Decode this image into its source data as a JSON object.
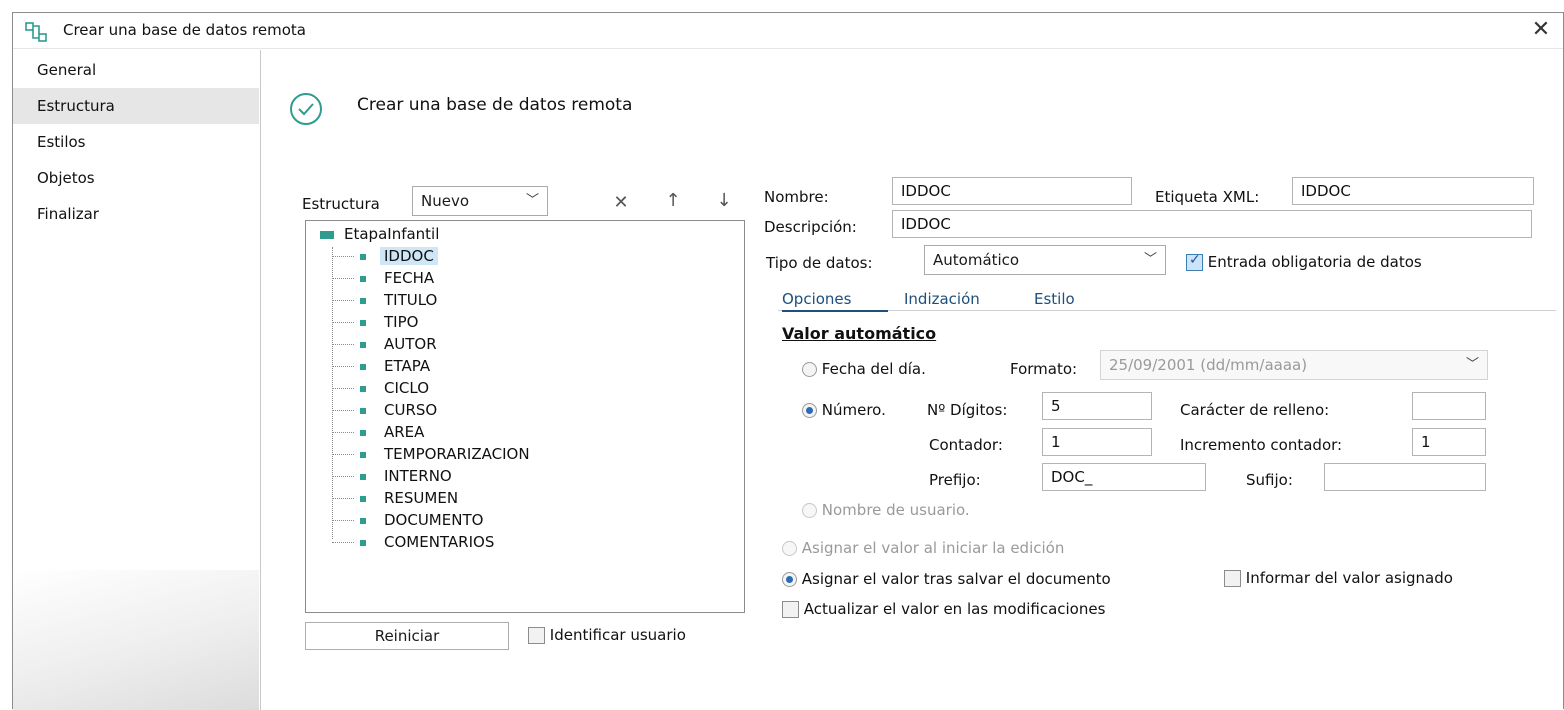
{
  "window": {
    "title": "Crear una base de datos remota"
  },
  "sidebar": {
    "items": [
      {
        "label": "General"
      },
      {
        "label": "Estructura"
      },
      {
        "label": "Estilos"
      },
      {
        "label": "Objetos"
      },
      {
        "label": "Finalizar"
      }
    ],
    "active_index": 1
  },
  "header": {
    "title": "Crear una base de datos remota"
  },
  "structure": {
    "label": "Estructura",
    "new_combo_value": "Nuevo",
    "delete_icon": "close-icon",
    "up_icon": "arrow-up-icon",
    "down_icon": "arrow-down-icon",
    "tree": {
      "root": "EtapaInfantil",
      "nodes": [
        "IDDOC",
        "FECHA",
        "TITULO",
        "TIPO",
        "AUTOR",
        "ETAPA",
        "CICLO",
        "CURSO",
        "AREA",
        "TEMPORARIZACION",
        "INTERNO",
        "RESUMEN",
        "DOCUMENTO",
        "COMENTARIOS"
      ],
      "selected": "IDDOC"
    },
    "reset_button": "Reiniciar",
    "identify_user_label": "Identificar usuario",
    "identify_user_checked": false
  },
  "field": {
    "nombre_label": "Nombre:",
    "nombre_value": "IDDOC",
    "xml_label": "Etiqueta XML:",
    "xml_value": "IDDOC",
    "descripcion_label": "Descripción:",
    "descripcion_value": "IDDOC",
    "tipo_label": "Tipo de datos:",
    "tipo_value": "Automático",
    "obligatoria_label": "Entrada obligatoria de datos",
    "obligatoria_checked": true
  },
  "tabs": [
    {
      "label": "Opciones"
    },
    {
      "label": "Indización"
    },
    {
      "label": "Estilo"
    }
  ],
  "active_tab": 0,
  "options": {
    "section_title": "Valor automático",
    "fecha_label": "Fecha del día.",
    "formato_label": "Formato:",
    "formato_value": "25/09/2001 (dd/mm/aaaa)",
    "numero_label": "Número.",
    "digitos_label": "Nº Dígitos:",
    "digitos_value": "5",
    "relleno_label": "Carácter de relleno:",
    "relleno_value": "",
    "contador_label": "Contador:",
    "contador_value": "1",
    "incremento_label": "Incremento contador:",
    "incremento_value": "1",
    "prefijo_label": "Prefijo:",
    "prefijo_value": "DOC_",
    "sufijo_label": "Sufijo:",
    "sufijo_value": "",
    "usuario_label": "Nombre de usuario.",
    "selected_mode": "numero",
    "asignar_inicio_label": "Asignar el valor al iniciar la edición",
    "asignar_salvar_label": "Asignar el valor tras salvar el documento",
    "asignar_selected": "salvar",
    "informar_label": "Informar del valor asignado",
    "informar_checked": false,
    "actualizar_label": "Actualizar el valor en las modificaciones",
    "actualizar_checked": false
  },
  "colors": {
    "accent": "#2f9c8f",
    "link": "#1e4f7d",
    "selection": "#cfe6f7"
  }
}
